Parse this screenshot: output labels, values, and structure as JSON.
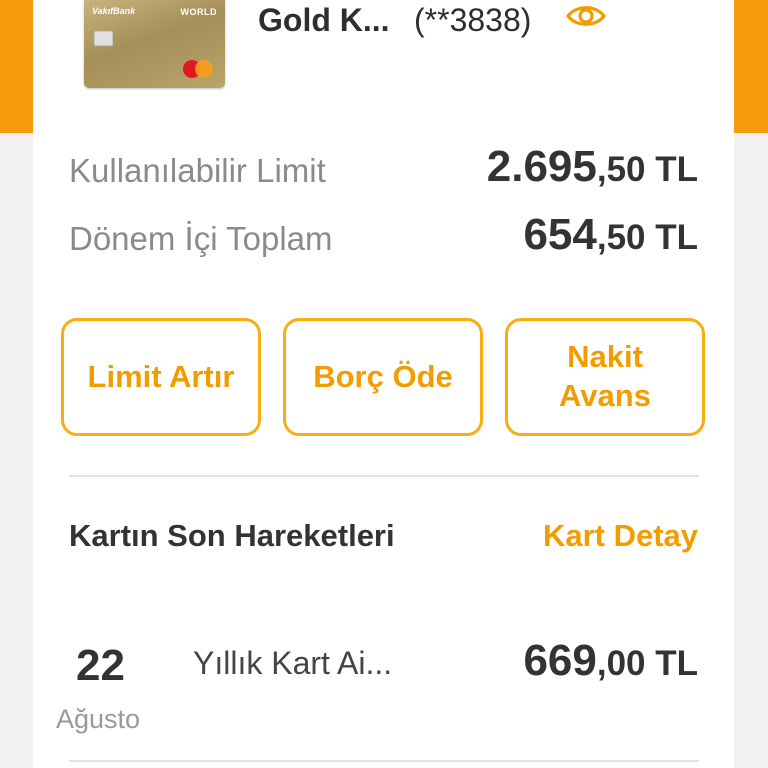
{
  "card": {
    "bank_logo_text": "VakıfBank",
    "tier_text": "WORLD",
    "name": "Gold K...",
    "masked_number": "(**3838)",
    "eye_icon": "eye-icon"
  },
  "limits": {
    "available_label": "Kullanılabilir Limit",
    "available_whole": "2.695",
    "available_fraction": ",50 TL",
    "period_label": "Dönem İçi Toplam",
    "period_whole": "654",
    "period_fraction": ",50 TL"
  },
  "actions": {
    "limit_increase": "Limit Artır",
    "pay_debt": "Borç Öde",
    "cash_advance_line1": "Nakit",
    "cash_advance_line2": "Avans"
  },
  "transactions": {
    "title": "Kartın Son Hareketleri",
    "detail_link": "Kart Detay",
    "items": [
      {
        "day": "22",
        "month": "Ağusto",
        "description": "Yıllık Kart Ai...",
        "amount_whole": "669",
        "amount_fraction": ",00 TL"
      }
    ]
  },
  "colors": {
    "accent": "#f39c00",
    "accent_border": "#f9ad0e",
    "header_orange": "#f79a0b"
  }
}
